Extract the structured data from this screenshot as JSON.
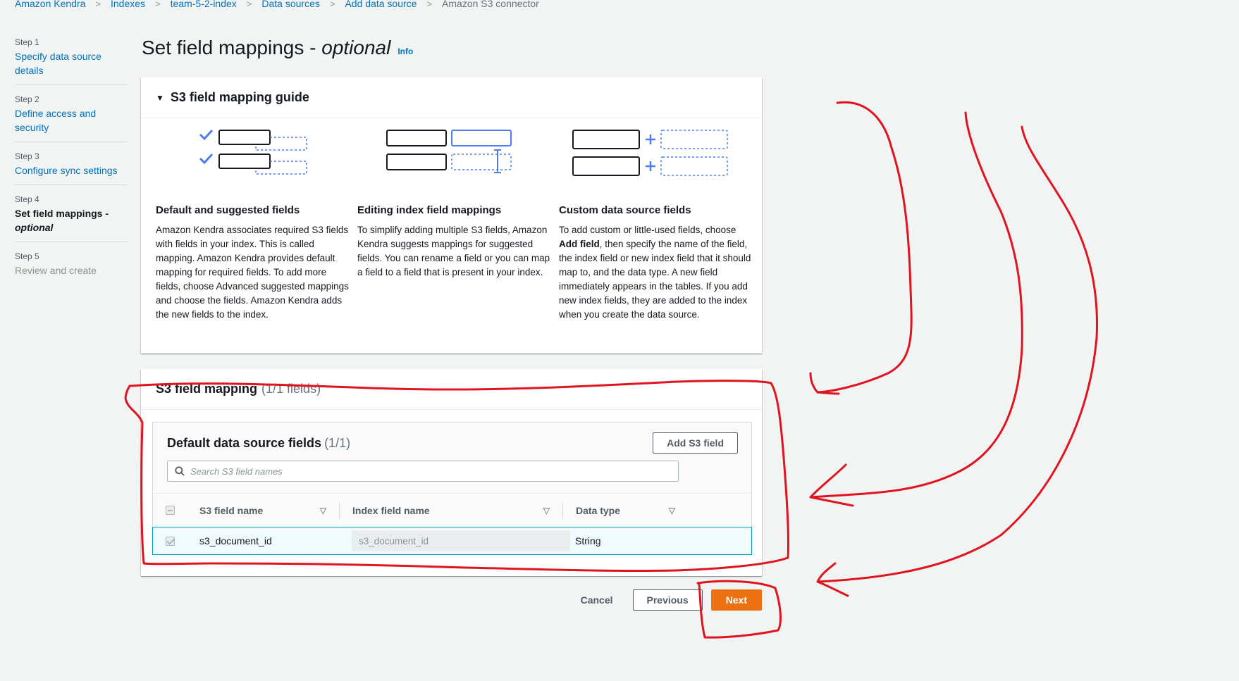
{
  "breadcrumb": {
    "items": [
      "Amazon Kendra",
      "Indexes",
      "team-5-2-index",
      "Data sources",
      "Add data source"
    ],
    "current": "Amazon S3 connector"
  },
  "steps": [
    {
      "num": "Step 1",
      "title": "Specify data source details"
    },
    {
      "num": "Step 2",
      "title": "Define access and security"
    },
    {
      "num": "Step 3",
      "title": "Configure sync settings"
    },
    {
      "num": "Step 4",
      "title": "Set field mappings -",
      "title_em": "optional"
    },
    {
      "num": "Step 5",
      "title": "Review and create"
    }
  ],
  "page": {
    "title": "Set field mappings - ",
    "title_em": "optional",
    "info": "Info"
  },
  "guide": {
    "title": "S3 field mapping guide",
    "cols": [
      {
        "heading": "Default and suggested fields",
        "body": "Amazon Kendra associates required S3 fields with fields in your index. This is called mapping. Amazon Kendra provides default mapping for required fields. To add more fields, choose Advanced suggested mappings and choose the fields. Amazon Kendra adds the new fields to the index."
      },
      {
        "heading": "Editing index field mappings",
        "body": "To simplify adding multiple S3 fields, Amazon Kendra suggests mappings for suggested fields. You can rename a field or you can map a field to a field that is present in your index."
      },
      {
        "heading": "Custom data source fields",
        "body_pre": "To add custom or little-used fields, choose ",
        "body_bold": "Add field",
        "body_post": ", then specify the name of the field, the index field or new index field that it should map to, and the data type. A new field immediately appears in the tables. If you add new index fields, they are added to the index when you create the data source."
      }
    ]
  },
  "mapping": {
    "title": "S3 field mapping",
    "count": "(1/1 fields)",
    "inner_title": "Default data source fields",
    "inner_count": "(1/1)",
    "add_button": "Add S3 field",
    "search_placeholder": "Search S3 field names",
    "columns": [
      "S3 field name",
      "Index field name",
      "Data type"
    ],
    "rows": [
      {
        "s3_field": "s3_document_id",
        "index_field": "s3_document_id",
        "data_type": "String"
      }
    ]
  },
  "actions": {
    "cancel": "Cancel",
    "previous": "Previous",
    "next": "Next"
  },
  "colors": {
    "link": "#0073bb",
    "primary": "#ec7211",
    "illustration": "#4e7cf0",
    "annotation": "#e0141e"
  }
}
